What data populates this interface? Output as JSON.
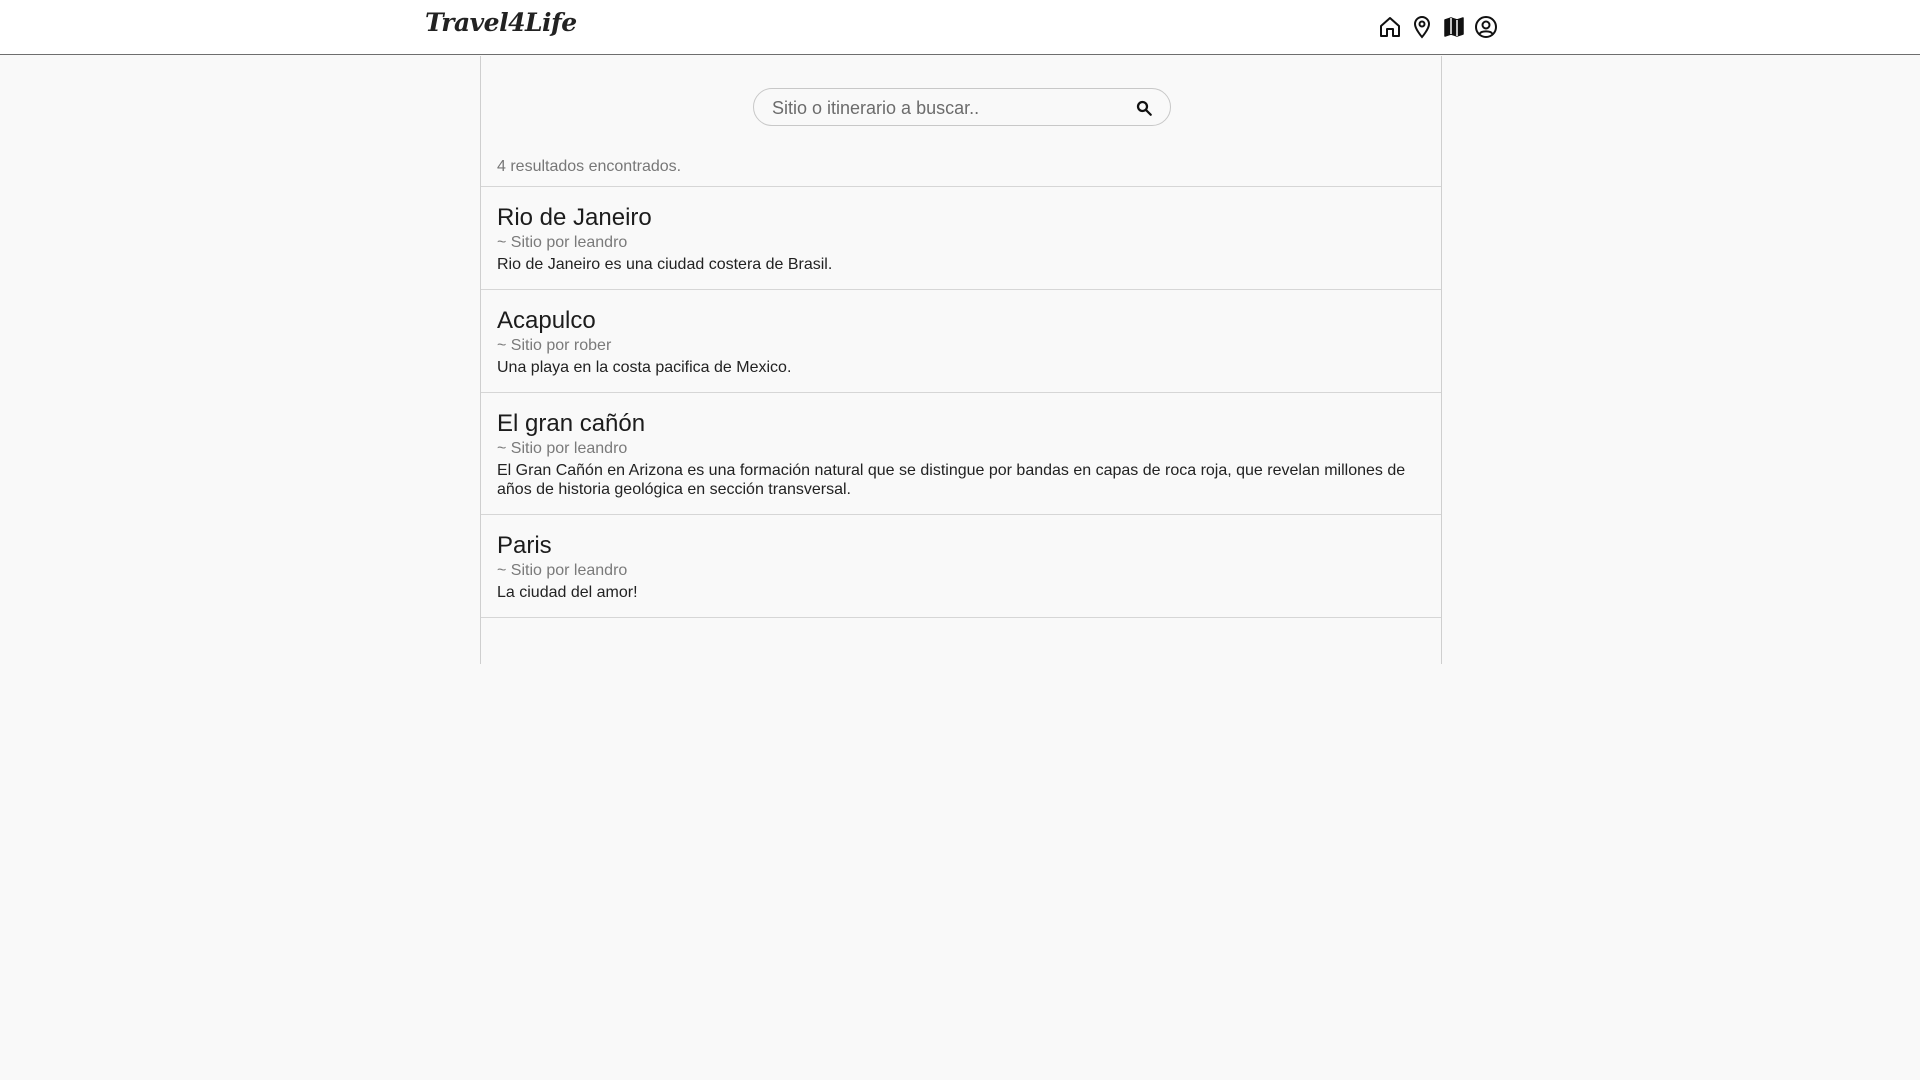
{
  "header": {
    "logo": "Travel4Life",
    "icons": [
      {
        "name": "home-icon"
      },
      {
        "name": "location-pin-icon"
      },
      {
        "name": "map-icon"
      },
      {
        "name": "user-account-icon"
      }
    ]
  },
  "search": {
    "placeholder": "Sitio o itinerario a buscar..",
    "value": ""
  },
  "results": {
    "count_text": "4 resultados encontrados.",
    "items": [
      {
        "title": "Rio de Janeiro",
        "author": "~ Sitio por leandro",
        "description": "Rio de Janeiro es una ciudad costera de Brasil."
      },
      {
        "title": "Acapulco",
        "author": "~ Sitio por rober",
        "description": "Una playa en la costa pacifica de Mexico."
      },
      {
        "title": "El gran cañón",
        "author": "~ Sitio por leandro",
        "description": "El Gran Cañón en Arizona es una formación natural que se distingue por bandas en capas de roca roja, que revelan millones de años de historia geológica en sección transversal."
      },
      {
        "title": "Paris",
        "author": "~ Sitio por leandro",
        "description": "La ciudad del amor!"
      }
    ]
  }
}
